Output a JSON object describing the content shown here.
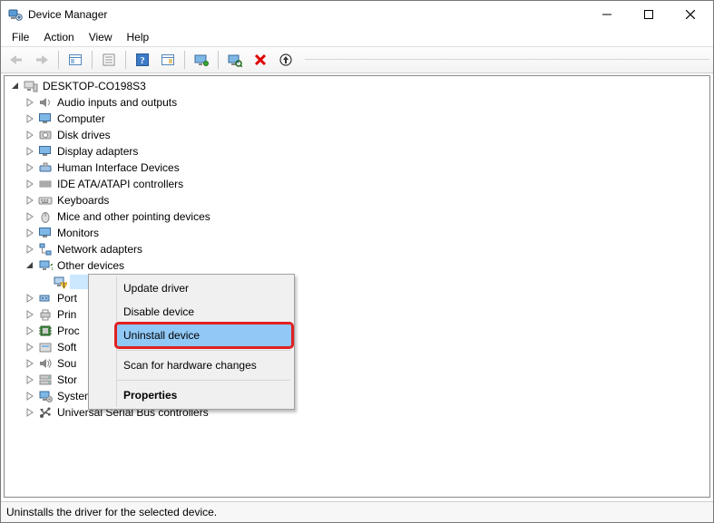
{
  "window": {
    "title": "Device Manager"
  },
  "menu": {
    "file": "File",
    "action": "Action",
    "view": "View",
    "help": "Help"
  },
  "toolbar": {
    "back": "Back",
    "forward": "Forward",
    "show_hidden": "Show hidden devices",
    "properties": "Properties",
    "help": "Help",
    "details": "Details",
    "monitor": "Monitor",
    "scan": "Scan for hardware changes",
    "uninstall": "Uninstall device",
    "update": "Update driver"
  },
  "tree": {
    "root": "DESKTOP-CO198S3",
    "items": [
      {
        "label": "Audio inputs and outputs",
        "icon": "speaker"
      },
      {
        "label": "Computer",
        "icon": "monitor"
      },
      {
        "label": "Disk drives",
        "icon": "disk"
      },
      {
        "label": "Display adapters",
        "icon": "monitor"
      },
      {
        "label": "Human Interface Devices",
        "icon": "hid"
      },
      {
        "label": "IDE ATA/ATAPI controllers",
        "icon": "ide"
      },
      {
        "label": "Keyboards",
        "icon": "keyboard"
      },
      {
        "label": "Mice and other pointing devices",
        "icon": "mouse"
      },
      {
        "label": "Monitors",
        "icon": "monitor"
      },
      {
        "label": "Network adapters",
        "icon": "network"
      },
      {
        "label": "Other devices",
        "icon": "other",
        "open": true,
        "children": [
          {
            "label": "",
            "icon": "unknown",
            "selected": true
          }
        ]
      },
      {
        "label": "Port",
        "icon": "port",
        "truncated": true
      },
      {
        "label": "Prin",
        "icon": "printer",
        "truncated": true
      },
      {
        "label": "Proc",
        "icon": "cpu",
        "truncated": true
      },
      {
        "label": "Soft",
        "icon": "soft",
        "truncated": true
      },
      {
        "label": "Sou",
        "icon": "sound",
        "truncated": true
      },
      {
        "label": "Stor",
        "icon": "storage",
        "truncated": true
      },
      {
        "label": "System devices",
        "icon": "system"
      },
      {
        "label": "Universal Serial Bus controllers",
        "icon": "usb"
      }
    ]
  },
  "context_menu": {
    "update": "Update driver",
    "disable": "Disable device",
    "uninstall": "Uninstall device",
    "scan": "Scan for hardware changes",
    "properties": "Properties"
  },
  "status": {
    "text": "Uninstalls the driver for the selected device."
  },
  "colors": {
    "highlight": "#90c8f6",
    "annotation": "#e02020"
  }
}
